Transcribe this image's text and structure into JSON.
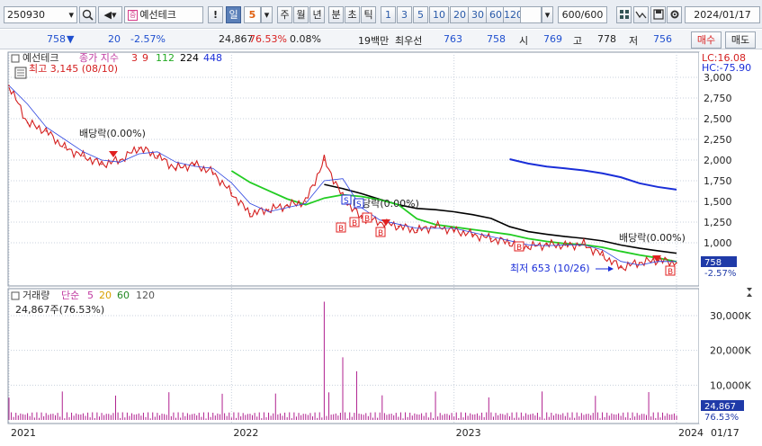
{
  "toolbar": {
    "code": "250930",
    "stock_badge": "증",
    "stock_name": "예선테크",
    "exclaim": "!",
    "period_day": "일",
    "period_num": "5",
    "week": "주",
    "month": "월",
    "year": "년",
    "minute": "분",
    "second": "초",
    "tick": "틱",
    "intervals": [
      "1",
      "3",
      "5",
      "10",
      "20",
      "30",
      "60",
      "120"
    ],
    "count": "600/600",
    "date": "2024/01/17"
  },
  "quote": {
    "price": "758",
    "down_arrow": "▼",
    "change": "20",
    "change_pct": "-2.57%",
    "volume": "24,867",
    "volume_ratio": "76.53%",
    "turnover": "0.08%",
    "amount_label": "19백만",
    "best_bid_label": "최우선",
    "best_ask": "763",
    "best_bid": "758",
    "open_label": "시",
    "open": "769",
    "high_label": "고",
    "high": "778",
    "low_label": "저",
    "low": "756",
    "buy_label": "매수",
    "sell_label": "매도"
  },
  "chart": {
    "legend": {
      "name": "예선테크",
      "type_label": "종가 지수",
      "ma": [
        "3",
        "9",
        "112",
        "224",
        "448"
      ]
    },
    "high_note": "최고 3,145 (08/10)",
    "low_note": "최저 653 (10/26)",
    "dividend_1": "배당락(0.00%)",
    "dividend_2": "배당락(0.00%)",
    "dividend_3": "배당락(0.00%)",
    "lc_label": "LC:16.08",
    "hc_label": "HC:-75.90",
    "price_ticks": [
      "3,000",
      "2,750",
      "2,500",
      "2,250",
      "2,000",
      "1,750",
      "1,500",
      "1,250",
      "1,000"
    ],
    "current_price": "758",
    "current_pct": "-2.57%",
    "volume_legend": {
      "label": "거래량",
      "type_label": "단순",
      "ma": [
        "5",
        "20",
        "60",
        "120"
      ]
    },
    "volume_note": "24,867주(76.53%)",
    "volume_ticks": [
      "30,000K",
      "20,000K",
      "10,000K"
    ],
    "current_volume": "24,867",
    "current_volume_pct": "76.53%",
    "x_ticks": [
      "2021",
      "2022",
      "2023",
      "2024"
    ],
    "axis_date": "01/17",
    "buy_marker": "B",
    "sell_marker": "S",
    "colors": {
      "price_line": "#d42020",
      "ma_green": "#22cc22",
      "ma_black": "#000000",
      "ma_blue": "#1a2ed8",
      "volume_bar": "#b0208f"
    },
    "price_series": [
      {
        "x": "2021-01",
        "y": 2900
      },
      {
        "x": "2021-02",
        "y": 2450
      },
      {
        "x": "2021-03",
        "y": 2350
      },
      {
        "x": "2021-04",
        "y": 2150
      },
      {
        "x": "2021-05",
        "y": 2050
      },
      {
        "x": "2021-06",
        "y": 1950
      },
      {
        "x": "2021-07",
        "y": 2000
      },
      {
        "x": "2021-08",
        "y": 2150
      },
      {
        "x": "2021-09",
        "y": 2050
      },
      {
        "x": "2021-10",
        "y": 1900
      },
      {
        "x": "2021-11",
        "y": 1950
      },
      {
        "x": "2021-12",
        "y": 1850
      },
      {
        "x": "2022-01",
        "y": 1600
      },
      {
        "x": "2022-02",
        "y": 1350
      },
      {
        "x": "2022-03",
        "y": 1400
      },
      {
        "x": "2022-04",
        "y": 1450
      },
      {
        "x": "2022-05",
        "y": 1500
      },
      {
        "x": "2022-06",
        "y": 2000
      },
      {
        "x": "2022-07",
        "y": 1550
      },
      {
        "x": "2022-08",
        "y": 1300
      },
      {
        "x": "2022-09",
        "y": 1250
      },
      {
        "x": "2022-10",
        "y": 1200
      },
      {
        "x": "2022-11",
        "y": 1150
      },
      {
        "x": "2022-12",
        "y": 1200
      },
      {
        "x": "2023-01",
        "y": 1150
      },
      {
        "x": "2023-02",
        "y": 1100
      },
      {
        "x": "2023-03",
        "y": 1050
      },
      {
        "x": "2023-04",
        "y": 1000
      },
      {
        "x": "2023-05",
        "y": 950
      },
      {
        "x": "2023-06",
        "y": 980
      },
      {
        "x": "2023-07",
        "y": 970
      },
      {
        "x": "2023-08",
        "y": 980
      },
      {
        "x": "2023-09",
        "y": 850
      },
      {
        "x": "2023-10",
        "y": 700
      },
      {
        "x": "2023-11",
        "y": 760
      },
      {
        "x": "2023-12",
        "y": 790
      },
      {
        "x": "2024-01",
        "y": 758
      }
    ]
  }
}
